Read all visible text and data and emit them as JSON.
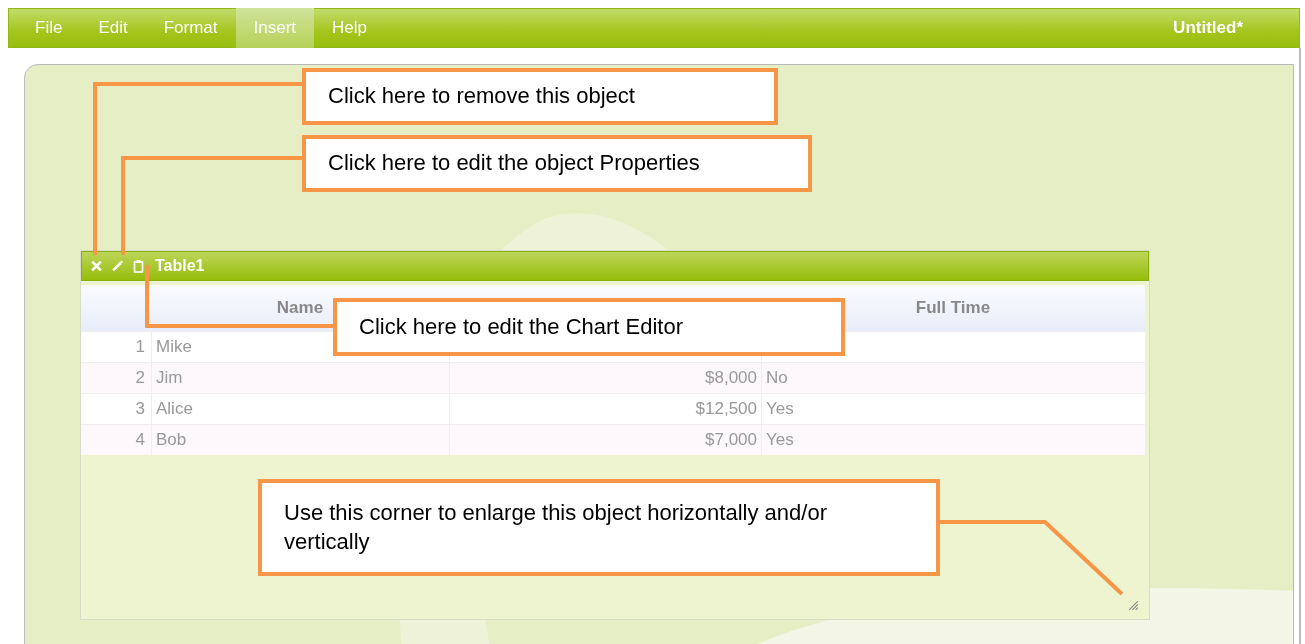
{
  "menu": [
    {
      "label": "File",
      "selected": false
    },
    {
      "label": "Edit",
      "selected": false
    },
    {
      "label": "Format",
      "selected": false
    },
    {
      "label": "Insert",
      "selected": true
    },
    {
      "label": "Help",
      "selected": false
    }
  ],
  "document_title": "Untitled*",
  "table_widget": {
    "title": "Table1",
    "header": {
      "name": "Name",
      "full_time": "Full Time"
    },
    "rows": [
      {
        "index": "1",
        "name": "Mike"
      },
      {
        "index": "2",
        "name": "Jim",
        "salary": "$8,000",
        "full_time": "No"
      },
      {
        "index": "3",
        "name": "Alice",
        "salary": "$12,500",
        "full_time": "Yes"
      },
      {
        "index": "4",
        "name": "Bob",
        "salary": "$7,000",
        "full_time": "Yes"
      }
    ]
  },
  "callouts": [
    {
      "text": "Click here to remove this object"
    },
    {
      "text": "Click here to edit the object Properties"
    },
    {
      "text": "Click here to edit the Chart Editor"
    },
    {
      "text": "Use this corner to enlarge this object horizontally and/or vertically"
    }
  ]
}
